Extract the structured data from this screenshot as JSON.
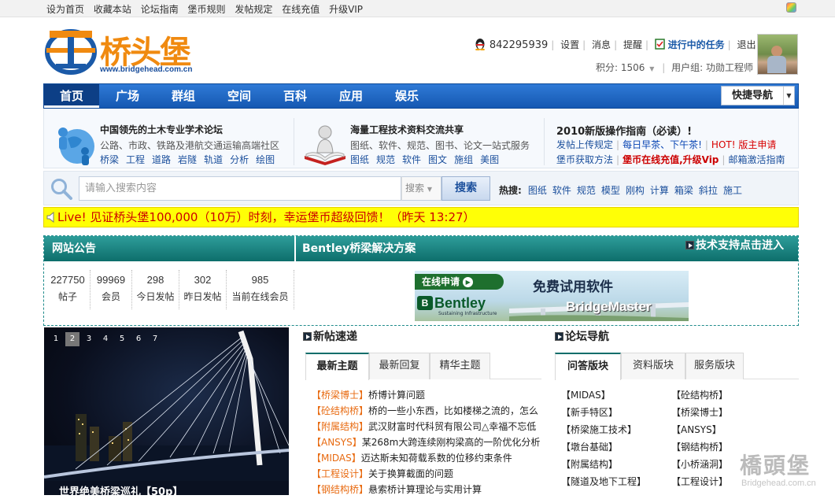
{
  "topbar": {
    "links": [
      "设为首页",
      "收藏本站",
      "论坛指南",
      "堡币规则",
      "发帖规定",
      "在线充值",
      "升级VIP"
    ]
  },
  "logo": {
    "name": "桥头堡",
    "url": "www.bridgehead.com.cn"
  },
  "user": {
    "qq": "842295939",
    "links": [
      "设置",
      "消息",
      "提醒"
    ],
    "task": "进行中的任务",
    "logout": "退出",
    "points_label": "积分: 1506",
    "group_label": "用户组: 功勋工程师"
  },
  "nav": {
    "items": [
      "首页",
      "广场",
      "群组",
      "空间",
      "百科",
      "应用",
      "娱乐"
    ],
    "quick_nav": "快捷导航"
  },
  "info": {
    "block1": {
      "title": "中国领先的土木专业学术论坛",
      "line": "公路、市政、铁路及港航交通运输高端社区",
      "links": [
        "桥梁",
        "工程",
        "道路",
        "岩隧",
        "轨道",
        "分析",
        "绘图"
      ]
    },
    "block2": {
      "title": "海量工程技术资料交流共享",
      "line": "图纸、软件、规范、图书、论文一站式服务",
      "links": [
        "图纸",
        "规范",
        "软件",
        "图文",
        "施组",
        "美图"
      ]
    },
    "block3": {
      "title": "2010新版操作指南（必读）!",
      "row1": [
        "发帖上传规定",
        "每日早茶、下午茶!",
        "HOT! 版主申请"
      ],
      "row2": [
        "堡币获取方法",
        "堡币在线充值,升级Vip",
        "邮箱激活指南"
      ]
    }
  },
  "search": {
    "placeholder": "请输入搜索内容",
    "type": "搜索",
    "button": "搜索",
    "hot_label": "热搜:",
    "hot": [
      "图纸",
      "软件",
      "规范",
      "模型",
      "刚构",
      "计算",
      "箱梁",
      "斜拉",
      "施工"
    ]
  },
  "live": "Live! 见证桥头堡100,000（10万）时刻，幸运堡币超级回馈！（昨天 13:27）",
  "notice": {
    "title": "网站公告",
    "stats": [
      {
        "value": "227750",
        "label": "帖子"
      },
      {
        "value": "99969",
        "label": "会员"
      },
      {
        "value": "298",
        "label": "今日发帖"
      },
      {
        "value": "302",
        "label": "昨日发帖"
      },
      {
        "value": "985",
        "label": "当前在线会员"
      }
    ]
  },
  "bentley": {
    "title": "Bentley桥梁解决方案",
    "support": "技术支持点击进入",
    "banner": {
      "apply": "在线申请",
      "free": "免费试用软件",
      "logo": "Bentley",
      "sub": "Sustaining Infrastructure",
      "product": "BridgeMaster"
    }
  },
  "slideshow": {
    "numbers": [
      "1",
      "2",
      "3",
      "4",
      "5",
      "6",
      "7"
    ],
    "active": 2,
    "caption": "世界绝美桥梁巡礼【50p】"
  },
  "newposts": {
    "title": "新帖速递",
    "tabs": [
      "最新主题",
      "最新回复",
      "精华主题"
    ],
    "posts": [
      {
        "tag": "【桥梁博士】",
        "text": "桥博计算问题"
      },
      {
        "tag": "【砼结构桥】",
        "text": "桥的一些小东西，比如楼梯之流的，怎么"
      },
      {
        "tag": "【附属结构】",
        "text": "武汉财富时代科贸有限公司△幸福不忘低"
      },
      {
        "tag": "【ANSYS】",
        "text": "某268m大跨连续刚构梁高的一阶优化分析"
      },
      {
        "tag": "【MIDAS】",
        "text": "迈达斯未知荷载系数的位移约束条件"
      },
      {
        "tag": "【工程设计】",
        "text": "关于换算截面的问题"
      },
      {
        "tag": "【钢结构桥】",
        "text": "悬索桥计算理论与实用计算"
      }
    ]
  },
  "forumnav": {
    "title": "论坛导航",
    "tabs": [
      "问答版块",
      "资料版块",
      "服务版块"
    ],
    "col1": [
      "【MIDAS】",
      "【新手特区】",
      "【桥梁施工技术】",
      "【墩台基础】",
      "【附属结构】",
      "【隧道及地下工程】"
    ],
    "col2": [
      "【砼结构桥】",
      "【桥梁博士】",
      "【ANSYS】",
      "【钢结构桥】",
      "【小桥涵洞】",
      "【工程设计】"
    ]
  },
  "watermark": {
    "text": "橋頭堡",
    "url": "Bridgehead.com.cn"
  },
  "colors": {
    "nav_blue": "#1558b2",
    "teal": "#0d6e6b",
    "live_yellow": "#ffff06",
    "tag_orange": "#e86a10",
    "link_blue": "#1b4f9c"
  }
}
